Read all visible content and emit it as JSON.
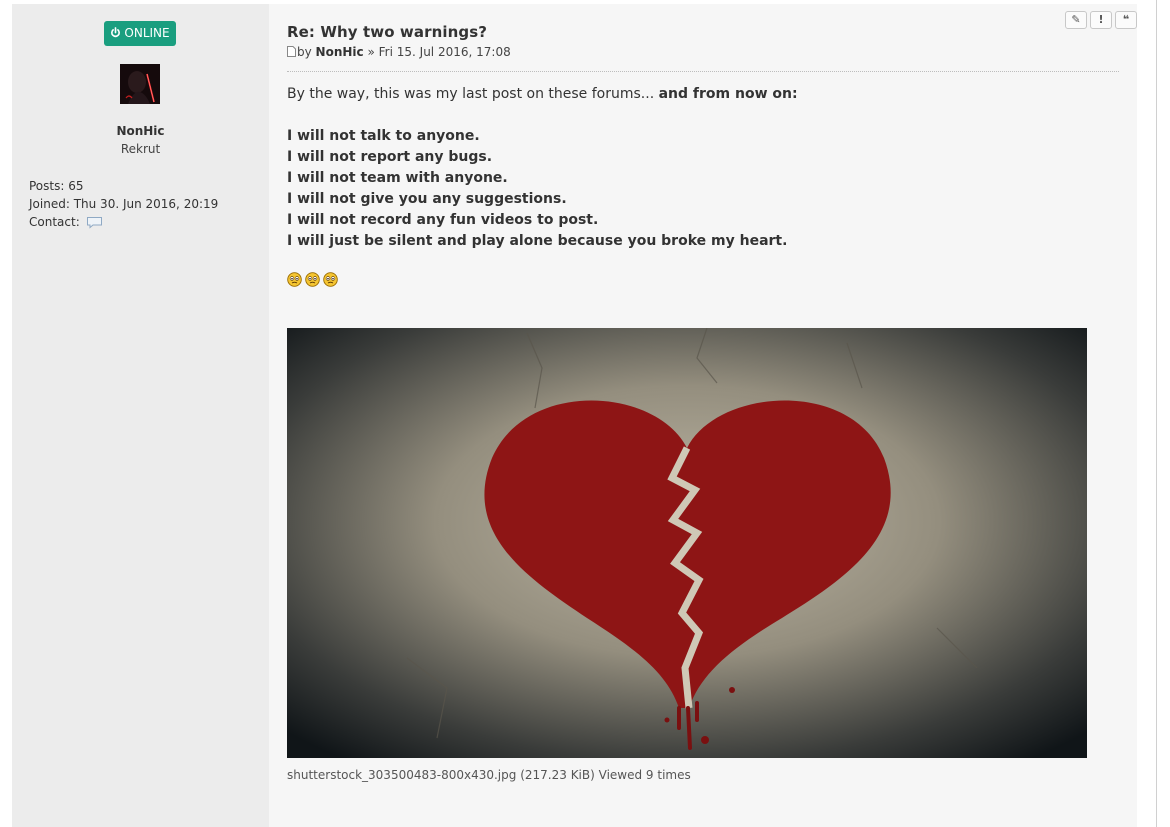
{
  "profile": {
    "status_label": "ONLINE",
    "username": "NonHic",
    "rank": "Rekrut",
    "posts_label": "Posts:",
    "posts_value": "65",
    "joined_label": "Joined:",
    "joined_value": "Thu 30. Jun 2016, 20:19",
    "contact_label": "Contact:"
  },
  "post": {
    "title": "Re: Why two warnings?",
    "by_prefix": "by",
    "author": "NonHic",
    "date_separator": "»",
    "date": "Fri 15. Jul 2016, 17:08",
    "actions": [
      {
        "name": "edit-button",
        "icon": "pencil-icon",
        "glyph": "✎"
      },
      {
        "name": "report-button",
        "icon": "exclamation-icon",
        "glyph": "!"
      },
      {
        "name": "quote-button",
        "icon": "quote-icon",
        "glyph": "❝"
      }
    ],
    "intro_plain": "By the way, this was my last post on these forums...",
    "intro_bold": "and from now on:",
    "lines": [
      "I will not talk to anyone.",
      "I will not report any bugs.",
      "I will not team with anyone.",
      "I will not give you any suggestions.",
      "I will not record any fun videos to post.",
      "I will just be silent and play alone because you broke my heart."
    ],
    "smileys": [
      "worried-smiley-icon",
      "worried-smiley-icon",
      "worried-smiley-icon"
    ],
    "attachment": {
      "filename": "shutterstock_303500483-800x430.jpg",
      "size": "(217.23 KiB)",
      "views": "Viewed 9 times"
    }
  },
  "colors": {
    "online_badge": "#1a9e7f",
    "heart": "#8e1515",
    "post_bg": "#f6f6f6",
    "profile_bg": "#ececec"
  }
}
